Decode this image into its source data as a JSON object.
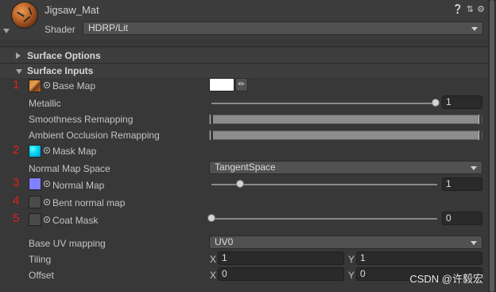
{
  "header": {
    "title": "Jigsaw_Mat",
    "shader_label": "Shader",
    "shader_value": "HDRP/Lit",
    "icons": [
      "help-icon",
      "preset-icon",
      "settings-icon"
    ]
  },
  "sections": {
    "surface_options": "Surface Options",
    "surface_inputs": "Surface Inputs"
  },
  "rows": {
    "base_map": {
      "number": "1",
      "label": "Base Map"
    },
    "metallic": {
      "label": "Metallic",
      "value": "1",
      "level": 1.0
    },
    "smoothness_remapping": {
      "label": "Smoothness Remapping"
    },
    "ao_remapping": {
      "label": "Ambient Occlusion Remapping"
    },
    "mask_map": {
      "number": "2",
      "label": "Mask Map"
    },
    "normal_map_space": {
      "label": "Normal Map Space",
      "value": "TangentSpace"
    },
    "normal_map": {
      "number": "3",
      "label": "Normal Map",
      "value": "1",
      "level": 0.125
    },
    "bent_normal_map": {
      "number": "4",
      "label": "Bent normal map"
    },
    "coat_mask": {
      "number": "5",
      "label": "Coat Mask",
      "value": "0",
      "level": 0.0
    },
    "base_uv_mapping": {
      "label": "Base UV mapping",
      "value": "UV0"
    },
    "tiling": {
      "label": "Tiling",
      "x_label": "X",
      "x": "1",
      "y_label": "Y",
      "y": "1"
    },
    "offset": {
      "label": "Offset",
      "x_label": "X",
      "x": "0",
      "y_label": "Y",
      "y": "0"
    }
  },
  "colors": {
    "background": "#383838",
    "annotation_red": "#e02020",
    "base_color": "#ffffff",
    "normal_swatch": "#8080ff",
    "mask_swatch": "#00e8ff"
  },
  "watermark": "CSDN @许毅宏"
}
